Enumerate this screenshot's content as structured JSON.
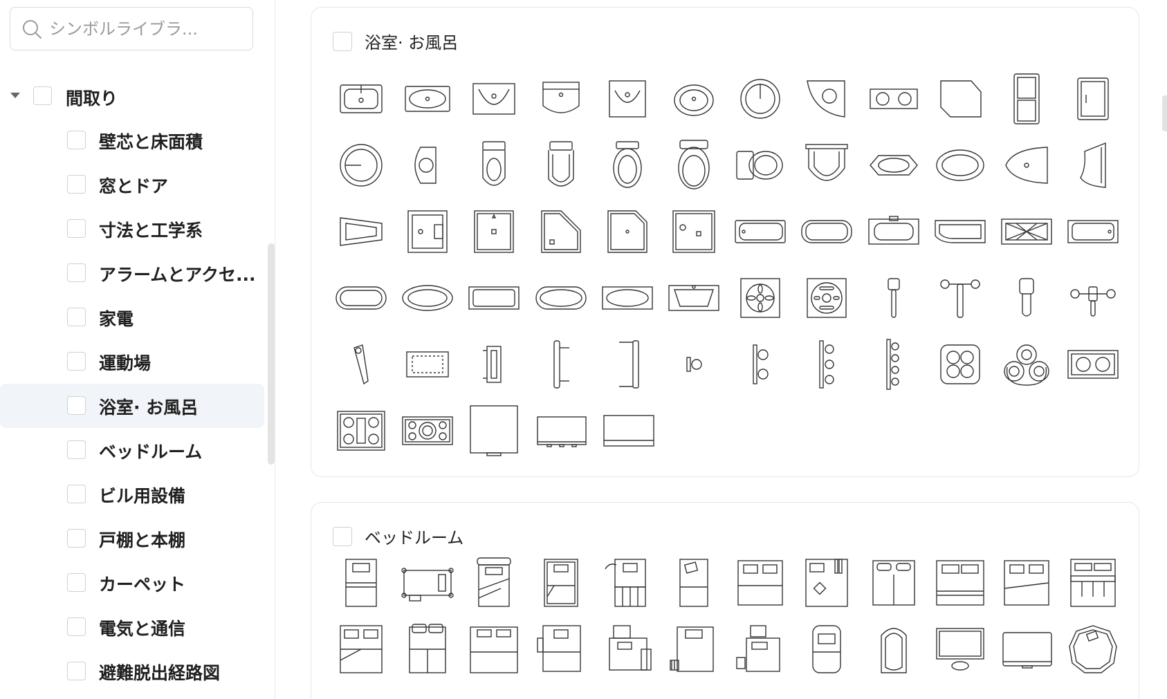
{
  "search": {
    "placeholder": "シンボルライブラ..."
  },
  "tree": {
    "root": {
      "label": "間取り"
    },
    "items": [
      {
        "label": "壁芯と床面積"
      },
      {
        "label": "窓とドア"
      },
      {
        "label": "寸法と工学系"
      },
      {
        "label": "アラームとアクセ..."
      },
      {
        "label": "家電"
      },
      {
        "label": "運動場"
      },
      {
        "label": "浴室· お風呂",
        "selected": true
      },
      {
        "label": "ベッドルーム"
      },
      {
        "label": "ビル用設備"
      },
      {
        "label": "戸棚と本棚"
      },
      {
        "label": "カーペット"
      },
      {
        "label": "電気と通信"
      },
      {
        "label": "避難脱出経路図"
      }
    ]
  },
  "panels": [
    {
      "title": "浴室· お風呂",
      "symbols": [
        "sink-rect-icon",
        "sink-oval-icon",
        "sink-vessel-icon",
        "sink-wall-icon",
        "sink-square-icon",
        "sink-round-icon",
        "sink-circle-icon",
        "sink-corner-icon",
        "sink-double-icon",
        "sink-angled-icon",
        "cabinet-double-icon",
        "cabinet-single-icon",
        "sink-circle-large-icon",
        "sink-small-round-icon",
        "toilet-icon",
        "toilet-alt-icon",
        "toilet-oval-icon",
        "toilet-round-icon",
        "toilet-side-icon",
        "bidet-icon",
        "bath-octagon-icon",
        "bath-oval-icon",
        "bath-corner-icon",
        "urinal-icon",
        "urinal-side-icon",
        "shower-stall-icon",
        "shower-square-icon",
        "shower-angled-icon",
        "shower-corner-icon",
        "shower-drain-icon",
        "bathtub-icon",
        "bathtub-round-icon",
        "bathtub-jet-icon",
        "bathtub-curved-icon",
        "bathtub-mat-icon",
        "bathtub-alt-icon",
        "bathtub-rounded-icon",
        "bathtub-oval-icon",
        "bathtub-straight-icon",
        "bathtub-capsule-icon",
        "bathtub-oval-alt-icon",
        "bathtub-whirlpool-icon",
        "drain-flower-icon",
        "drain-grate-icon",
        "faucet-icon",
        "faucet-tee-icon",
        "faucet-single-icon",
        "faucet-double-icon",
        "faucet-lever-icon",
        "bath-mat-icon",
        "towel-bar-short-icon",
        "towel-bar-icon",
        "towel-bar-long-icon",
        "hook-single-icon",
        "hook-double-icon",
        "hook-triple-icon",
        "hook-quad-icon",
        "cooktop-quad-icon",
        "jacuzzi-icon",
        "cooktop-double-icon",
        "cooktop-grill-icon",
        "cooktop-wide-icon",
        "cabinet-tall-icon",
        "counter-low-icon",
        "counter-wide-icon"
      ]
    },
    {
      "title": "ベッドルーム",
      "symbols": [
        "bed-single-icon",
        "bed-frame-icon",
        "bed-slanted-icon",
        "bed-bunk-icon",
        "bed-table-icon",
        "bed-narrow-icon",
        "bed-double-icon",
        "bed-cluttered-icon",
        "bed-queen-icon",
        "bed-wide-icon",
        "bed-wide-alt-icon",
        "bed-storage-icon",
        "bed-twin-icon",
        "bed-double-pillows-icon",
        "bed-king-icon",
        "bed-nightstand-icon",
        "bed-desk-icon",
        "bed-shelf-icon",
        "bed-chair-icon",
        "bed-rounded-icon",
        "bed-oval-icon",
        "tv-stand-icon",
        "desk-monitor-icon",
        "table-round-icon"
      ]
    }
  ]
}
